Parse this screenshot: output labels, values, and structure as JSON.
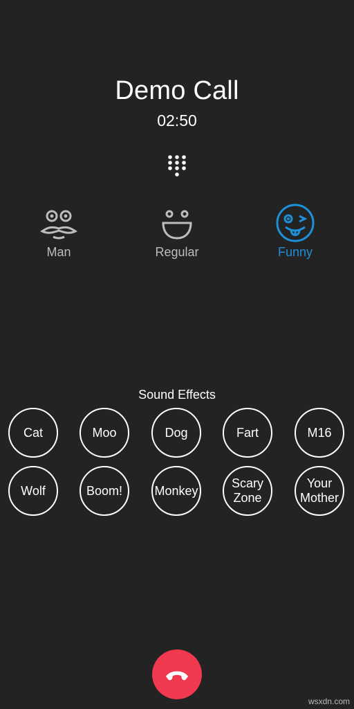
{
  "call": {
    "title": "Demo Call",
    "timer": "02:50"
  },
  "voices": {
    "selected": "funny",
    "options": [
      {
        "id": "man",
        "label": "Man",
        "icon": "mustache-face-icon"
      },
      {
        "id": "regular",
        "label": "Regular",
        "icon": "smile-face-icon"
      },
      {
        "id": "funny",
        "label": "Funny",
        "icon": "wink-tongue-face-icon"
      }
    ],
    "colors": {
      "selected": "#1e90d8",
      "unselected": "#bdbdbd"
    }
  },
  "sound_effects": {
    "heading": "Sound Effects",
    "row1": [
      "Cat",
      "Moo",
      "Dog",
      "Fart",
      "M16"
    ],
    "row2": [
      "Wolf",
      "Boom!",
      "Monkey",
      "Scary\nZone",
      "Your\nMother"
    ]
  },
  "end_call": {
    "icon": "phone-hangup-icon",
    "color": "#f0394f"
  },
  "watermark": "wsxdn.com"
}
